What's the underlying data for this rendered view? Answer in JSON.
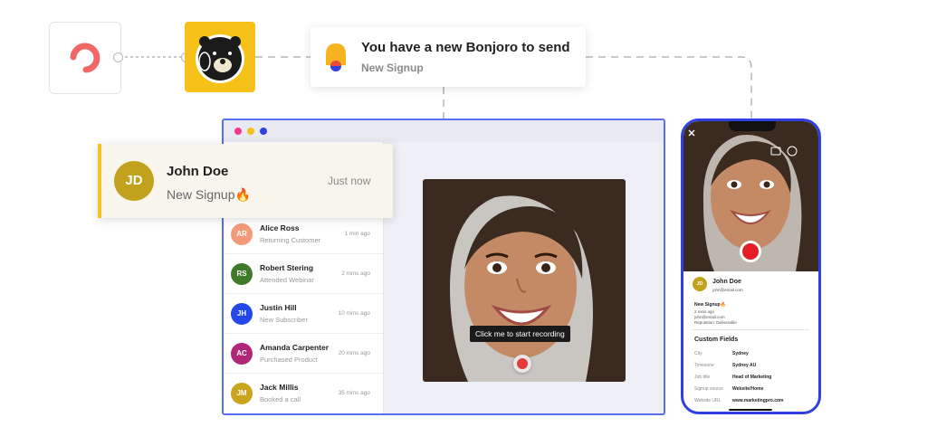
{
  "integrations": {
    "source_logo": "convertkit-style-logo",
    "app_logo": "bonjoro-bear-logo"
  },
  "notification_card": {
    "title": "You have a new Bonjoro to send",
    "subtitle": "New Signup",
    "icon": "bell-icon"
  },
  "popup": {
    "initials": "JD",
    "name": "John Doe",
    "subtitle": "New Signup🔥",
    "time": "Just now"
  },
  "contacts": [
    {
      "initials": "AR",
      "name": "Alice Ross",
      "status": "Returning Customer",
      "time": "1 min ago",
      "color": "#f39a7a"
    },
    {
      "initials": "RS",
      "name": "Robert Stering",
      "status": "Attended Webinar",
      "time": "2 mins ago",
      "color": "#3f7a2a"
    },
    {
      "initials": "JH",
      "name": "Justin Hill",
      "status": "New Subscriber",
      "time": "10 mins ago",
      "color": "#2447e8"
    },
    {
      "initials": "AC",
      "name": "Amanda Carpenter",
      "status": "Purchased Product",
      "time": "20 mins ago",
      "color": "#b0277a"
    },
    {
      "initials": "JM",
      "name": "Jack Millis",
      "status": "Booked a call",
      "time": "35 mins ago",
      "color": "#c9a41c"
    }
  ],
  "recorder": {
    "tooltip": "Click me to start recording"
  },
  "phone": {
    "contact_initials": "JD",
    "contact_name": "John Doe",
    "contact_email": "john@email.com",
    "event": "New Signup🔥",
    "event_time": "2 mins ago",
    "event_email": "john@email.com",
    "event_reputation": "Reputation: Deliverable",
    "custom_fields_title": "Custom Fields",
    "fields": [
      {
        "label": "City",
        "value": "Sydney"
      },
      {
        "label": "Timezone",
        "value": "Sydney AU"
      },
      {
        "label": "Job title",
        "value": "Head of Marketing"
      },
      {
        "label": "Signup source",
        "value": "Website/Home"
      },
      {
        "label": "Website URL",
        "value": "www.marketingpro.com"
      }
    ]
  },
  "colors": {
    "accent_blue": "#2f3fe0",
    "brand_yellow": "#f6c21a",
    "record_red": "#e53a3a"
  }
}
